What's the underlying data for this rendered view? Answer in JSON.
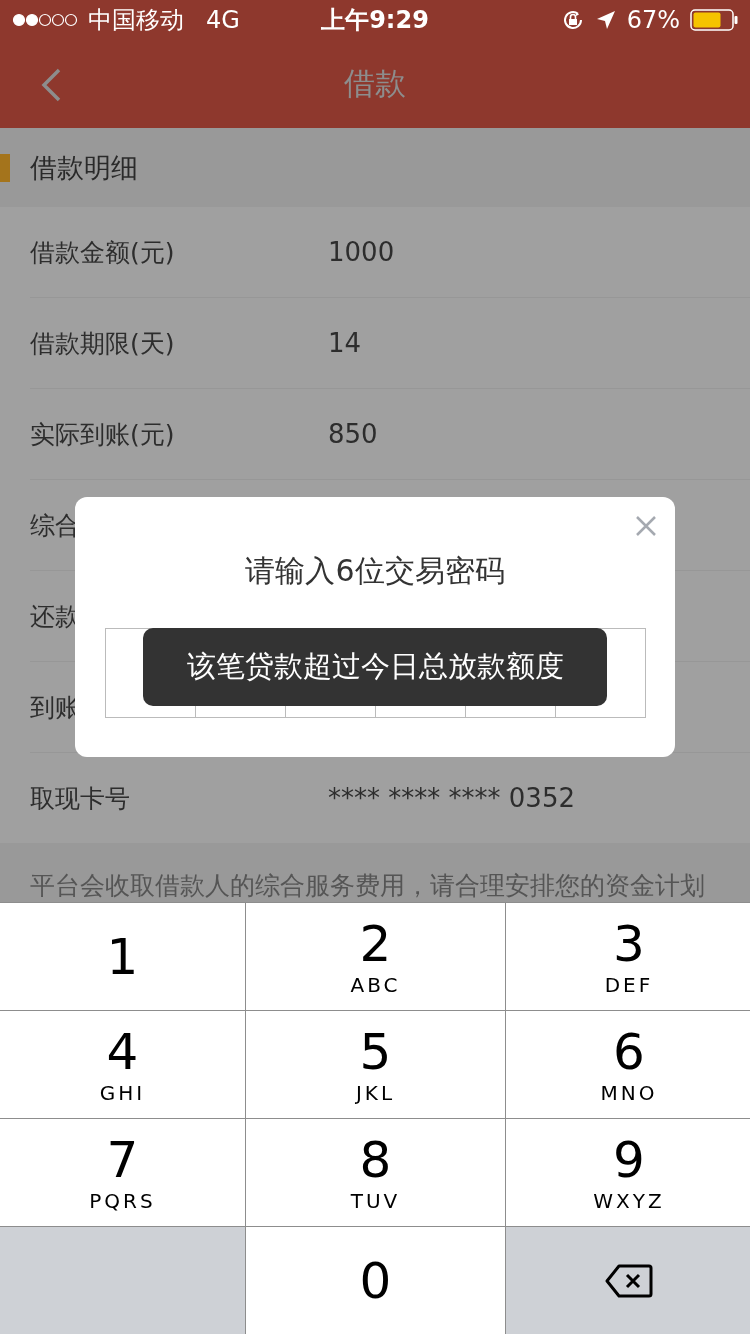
{
  "status_bar": {
    "carrier": "中国移动",
    "network": "4G",
    "time": "上午9:29",
    "battery": "67%"
  },
  "nav": {
    "title": "借款"
  },
  "section": {
    "title": "借款明细"
  },
  "rows": [
    {
      "label": "借款金额(元)",
      "value": "1000"
    },
    {
      "label": "借款期限(天)",
      "value": "14"
    },
    {
      "label": "实际到账(元)",
      "value": "850"
    },
    {
      "label": "综合"
    },
    {
      "label": "还款"
    },
    {
      "label": "到账"
    },
    {
      "label": "取现卡号",
      "value": "**** **** **** 0352"
    }
  ],
  "footnote": "平台会收取借款人的综合服务费用，请合理安排您的资金计划",
  "dialog": {
    "title": "请输入6位交易密码"
  },
  "toast": "该笔贷款超过今日总放款额度",
  "keypad": [
    {
      "kind": "digit",
      "digit": "1"
    },
    {
      "kind": "digit",
      "digit": "2",
      "letters": "ABC"
    },
    {
      "kind": "digit",
      "digit": "3",
      "letters": "DEF"
    },
    {
      "kind": "digit",
      "digit": "4",
      "letters": "GHI"
    },
    {
      "kind": "digit",
      "digit": "5",
      "letters": "JKL"
    },
    {
      "kind": "digit",
      "digit": "6",
      "letters": "MNO"
    },
    {
      "kind": "digit",
      "digit": "7",
      "letters": "PQRS"
    },
    {
      "kind": "digit",
      "digit": "8",
      "letters": "TUV"
    },
    {
      "kind": "digit",
      "digit": "9",
      "letters": "WXYZ"
    },
    {
      "kind": "blank"
    },
    {
      "kind": "digit",
      "digit": "0"
    },
    {
      "kind": "delete"
    }
  ]
}
